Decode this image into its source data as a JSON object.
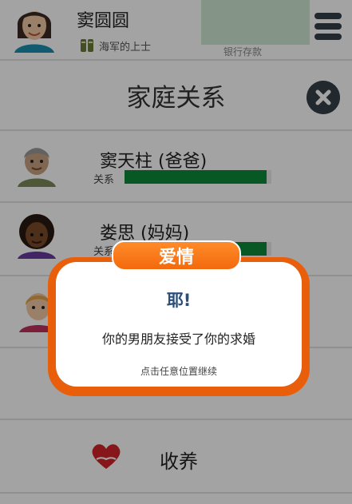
{
  "header": {
    "name": "窦圆圆",
    "rank": "海军的上士",
    "box_label": "银行存款"
  },
  "title": "家庭关系",
  "family": [
    {
      "name": "窦天柱 (爸爸)",
      "relation_label": "关系",
      "relationship": 0.97
    },
    {
      "name": "娄思 (妈妈)",
      "relation_label": "关系",
      "relationship": 0.97
    }
  ],
  "adopt": {
    "label": "收养"
  },
  "popup": {
    "tab": "爱情",
    "headline": "耶!",
    "message": "你的男朋友接受了你的求婚",
    "hint": "点击任意位置继续"
  },
  "colors": {
    "accent_orange": "#f36a0c",
    "relationship_green": "#0e8a3c",
    "close_button": "#35404a",
    "headline_blue": "#2b4f7a"
  }
}
